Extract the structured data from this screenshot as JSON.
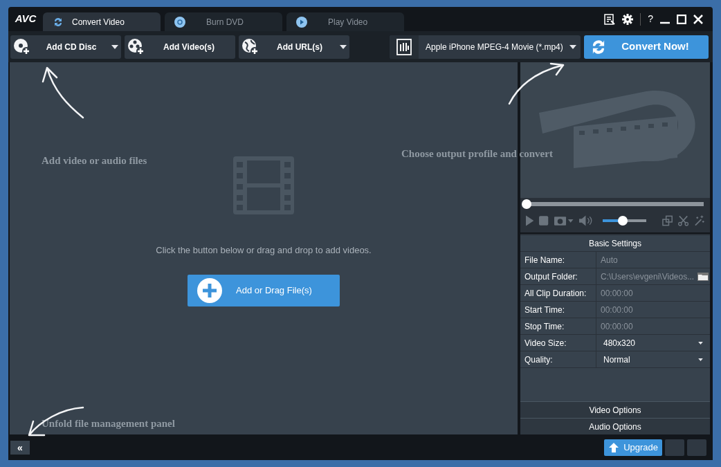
{
  "app": {
    "logo": "AVC"
  },
  "tabs": [
    {
      "label": "Convert Video",
      "selected": true,
      "kind": "convert"
    },
    {
      "label": "Burn DVD",
      "selected": false,
      "kind": "disc"
    },
    {
      "label": "Play Video",
      "selected": false,
      "kind": "play"
    }
  ],
  "help": "?",
  "toolbar": {
    "buttons": [
      {
        "label": "Add CD Disc",
        "kind": "cd",
        "dropdown": true
      },
      {
        "label": "Add Video(s)",
        "kind": "video",
        "dropdown": false
      },
      {
        "label": "Add URL(s)",
        "kind": "url",
        "dropdown": true
      }
    ],
    "profile": "Apple iPhone MPEG-4 Movie (*.mp4)",
    "convert": "Convert Now!"
  },
  "drop_area": {
    "hint": "Click the button below or drag and drop to add videos.",
    "button": "Add or Drag File(s)"
  },
  "annotations": [
    {
      "text": "Add video or audio files",
      "kind": "left"
    },
    {
      "text": "Choose output profile and convert",
      "kind": "right"
    },
    {
      "text": "Unfold file management panel",
      "kind": "bottom"
    }
  ],
  "player": {
    "progress": {
      "level": 0
    },
    "volume": {
      "level": 0.47
    }
  },
  "basic_settings": {
    "title": "Basic Settings",
    "rows": [
      {
        "label": "File Name:",
        "value": "Auto",
        "kind": "text",
        "muted": true
      },
      {
        "label": "Output Folder:",
        "value": "C:\\Users\\evgeni\\Videos...",
        "kind": "folder",
        "muted": true
      },
      {
        "label": "All Clip Duration:",
        "value": "00:00:00",
        "kind": "text",
        "muted": true
      },
      {
        "label": "Start Time:",
        "value": "00:00:00",
        "kind": "text",
        "muted": true
      },
      {
        "label": "Stop Time:",
        "value": "00:00:00",
        "kind": "text",
        "muted": true
      },
      {
        "label": "Video Size:",
        "value": "480x320",
        "kind": "select",
        "muted": false
      },
      {
        "label": "Quality:",
        "value": "Normal",
        "kind": "select",
        "muted": false
      }
    ]
  },
  "sections": [
    "Video Options",
    "Audio Options"
  ],
  "bottom": {
    "collapse": "«",
    "upgrade": "Upgrade"
  }
}
